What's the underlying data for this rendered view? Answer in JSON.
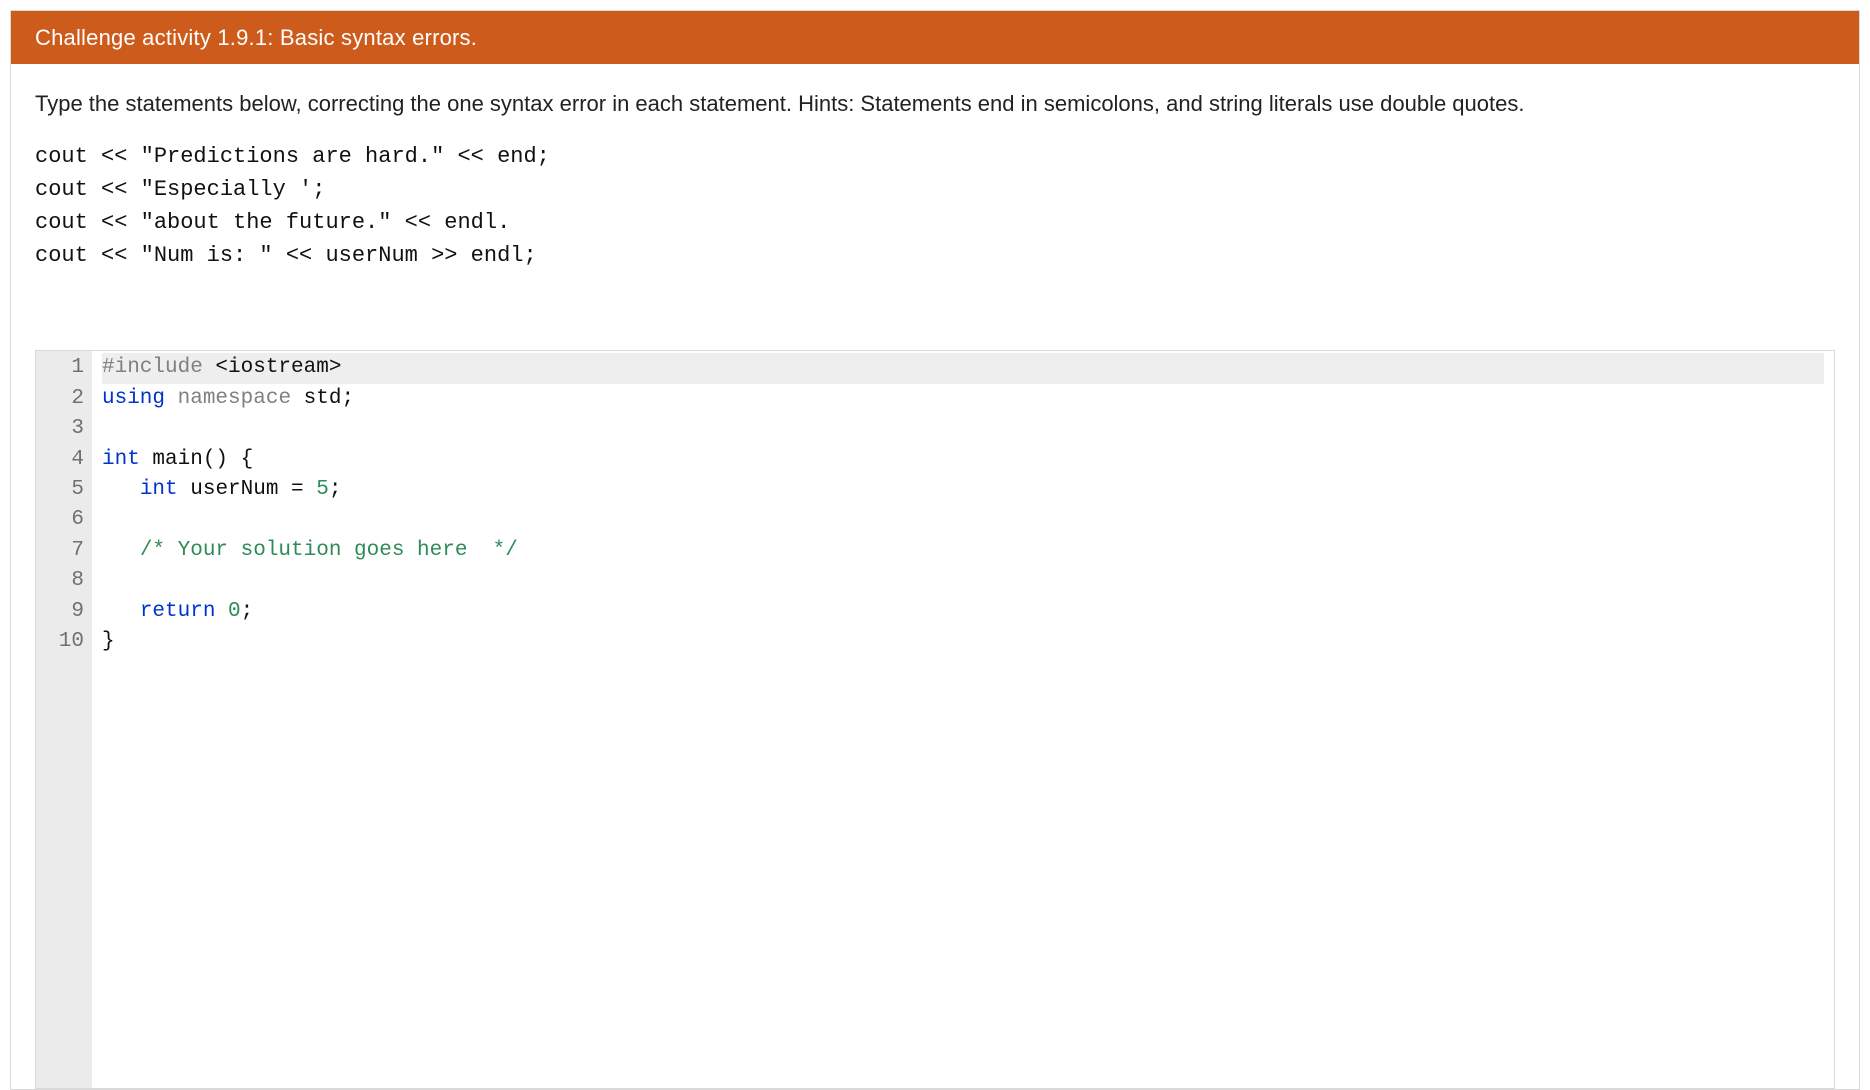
{
  "banner": {
    "label": "Challenge activity",
    "number": "1.9.1",
    "title": "Basic syntax errors."
  },
  "instructions": "Type the statements below, correcting the one syntax error in each statement. Hints: Statements end in semicolons, and string literals use double quotes.",
  "sample_lines": [
    "cout << \"Predictions are hard.\" << end;",
    "cout << \"Especially ';",
    "cout << \"about the future.\" << endl.",
    "cout << \"Num is: \" << userNum >> endl;"
  ],
  "editor": {
    "active_line_index": 0,
    "lines": [
      {
        "num": 1,
        "tokens": [
          {
            "cls": "pp",
            "t": "#include "
          },
          {
            "cls": "pl",
            "t": "<iostream>"
          }
        ]
      },
      {
        "num": 2,
        "tokens": [
          {
            "cls": "kw",
            "t": "using "
          },
          {
            "cls": "pp",
            "t": "namespace "
          },
          {
            "cls": "pl",
            "t": "std;"
          }
        ]
      },
      {
        "num": 3,
        "tokens": [
          {
            "cls": "pl",
            "t": ""
          }
        ]
      },
      {
        "num": 4,
        "tokens": [
          {
            "cls": "ty",
            "t": "int "
          },
          {
            "cls": "pl",
            "t": "main() {"
          }
        ]
      },
      {
        "num": 5,
        "tokens": [
          {
            "cls": "pl",
            "t": "   "
          },
          {
            "cls": "ty",
            "t": "int "
          },
          {
            "cls": "pl",
            "t": "userNum = "
          },
          {
            "cls": "nm",
            "t": "5"
          },
          {
            "cls": "pl",
            "t": ";"
          }
        ]
      },
      {
        "num": 6,
        "tokens": [
          {
            "cls": "pl",
            "t": ""
          }
        ]
      },
      {
        "num": 7,
        "tokens": [
          {
            "cls": "pl",
            "t": "   "
          },
          {
            "cls": "cm",
            "t": "/* Your solution goes here  */"
          }
        ]
      },
      {
        "num": 8,
        "tokens": [
          {
            "cls": "pl",
            "t": ""
          }
        ]
      },
      {
        "num": 9,
        "tokens": [
          {
            "cls": "pl",
            "t": "   "
          },
          {
            "cls": "kw",
            "t": "return "
          },
          {
            "cls": "nm",
            "t": "0"
          },
          {
            "cls": "pl",
            "t": ";"
          }
        ]
      },
      {
        "num": 10,
        "tokens": [
          {
            "cls": "pl",
            "t": "}"
          }
        ]
      }
    ]
  }
}
